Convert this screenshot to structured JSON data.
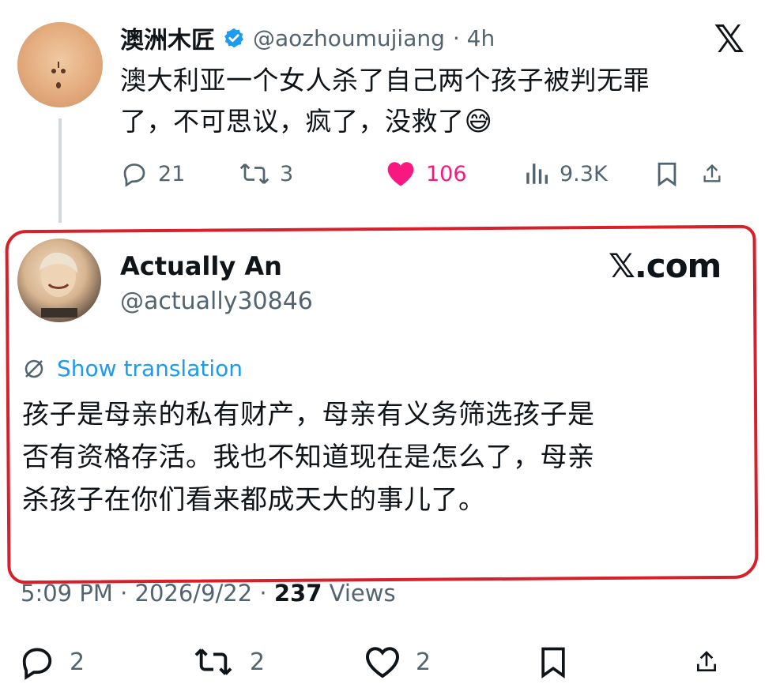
{
  "tweet1": {
    "display_name": "澳洲木匠",
    "handle": "@aozhoumujiang",
    "age": "· 4h",
    "text_line1": "澳大利亚一个女人杀了自己两个孩子被判无罪",
    "text_line2": "了，不可思议，疯了，没救了",
    "emoji": "😅",
    "replies": "21",
    "retweets": "3",
    "likes": "106",
    "views": "9.3K",
    "x_logo": "𝕏"
  },
  "tweet2": {
    "display_name": "Actually An",
    "handle": "@actually30846",
    "site_label": "𝕏.com",
    "translate_label": "Show translation",
    "text_line1": "孩子是母亲的私有财产，母亲有义务筛选孩子是",
    "text_line2": "否有资格存活。我也不知道现在是怎么了，母亲",
    "text_line3": "杀孩子在你们看来都成天大的事儿了。",
    "time": "5:09 PM · 2026/9/22 · ",
    "view_count": "237",
    "views_label": " Views",
    "replies": "2",
    "retweets": "2",
    "likes": "2"
  },
  "colors": {
    "like_pink": "#f91880",
    "link_blue": "#1d9bf0",
    "ring_red": "#d6202a",
    "muted": "#536471"
  },
  "icons": [
    "verified-icon",
    "reply-icon",
    "retweet-icon",
    "heart-icon",
    "views-icon",
    "bookmark-icon",
    "share-icon",
    "translate-icon",
    "x-logo-icon"
  ]
}
